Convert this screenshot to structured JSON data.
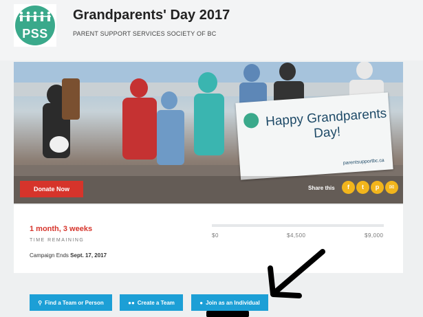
{
  "header": {
    "logo_text": "PSS",
    "title": "Grandparents' Day 2017",
    "organization": "PARENT SUPPORT SERVICES SOCIETY OF BC"
  },
  "hero": {
    "banner_text": "Happy Grandparents Day!",
    "banner_url": "parentsupportbc.ca",
    "donate_label": "Donate Now",
    "share_label": "Share this",
    "share_buttons": [
      "facebook",
      "twitter",
      "pinterest",
      "email"
    ]
  },
  "campaign": {
    "time_remaining": "1 month, 3 weeks",
    "time_remaining_label": "TIME REMAINING",
    "ends_prefix": "Campaign Ends",
    "ends_date": "Sept. 17, 2017",
    "progress_fraction": 0.0,
    "scale_labels": [
      "$0",
      "$4,500",
      "$9,000"
    ]
  },
  "actions": {
    "find_team": "Find a Team or Person",
    "create_team": "Create a Team",
    "join_individual": "Join as an Individual"
  },
  "colors": {
    "brand_green": "#3aa98b",
    "donate_red": "#d6342b",
    "action_blue": "#1c9fd6",
    "share_yellow": "#f2b51c"
  }
}
